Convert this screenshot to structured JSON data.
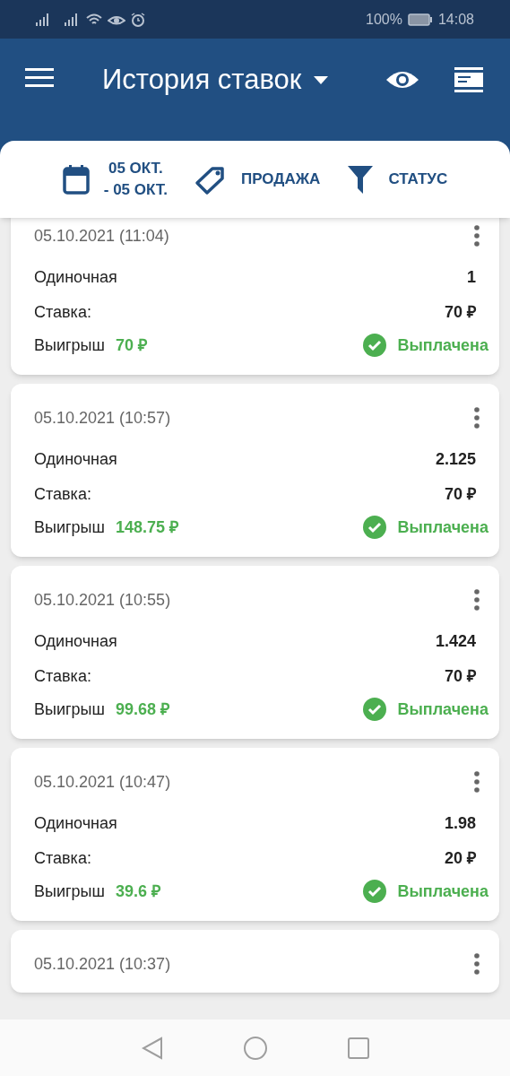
{
  "status_bar": {
    "battery_percent": "100%",
    "time": "14:08"
  },
  "header": {
    "title": "История ставок"
  },
  "filters": [
    {
      "kind": "date",
      "label": "05 ОКТ.\n- 05 ОКТ."
    },
    {
      "kind": "tag",
      "label": "ПРОДАЖА"
    },
    {
      "kind": "filter",
      "label": "СТАТУС"
    }
  ],
  "bets": [
    {
      "date": "05.10.2021 (11:04)",
      "type": "Одиночная",
      "odds": "1",
      "stake_label": "Ставка:",
      "stake": "70 ₽",
      "win_label": "Выигрыш",
      "win": "70 ₽",
      "status": "Выплачена",
      "kind": "paid"
    },
    {
      "date": "05.10.2021 (10:57)",
      "type": "Одиночная",
      "odds": "2.125",
      "stake_label": "Ставка:",
      "stake": "70 ₽",
      "win_label": "Выигрыш",
      "win": "148.75 ₽",
      "status": "Выплачена",
      "kind": "paid"
    },
    {
      "date": "05.10.2021 (10:55)",
      "type": "Одиночная",
      "odds": "1.424",
      "stake_label": "Ставка:",
      "stake": "70 ₽",
      "win_label": "Выигрыш",
      "win": "99.68 ₽",
      "status": "Выплачена",
      "kind": "paid"
    },
    {
      "date": "05.10.2021 (10:47)",
      "type": "Одиночная",
      "odds": "1.98",
      "stake_label": "Ставка:",
      "stake": "20 ₽",
      "win_label": "Выигрыш",
      "win": "39.6 ₽",
      "status": "Выплачена",
      "kind": "paid"
    },
    {
      "date": "05.10.2021 (10:37)"
    }
  ]
}
